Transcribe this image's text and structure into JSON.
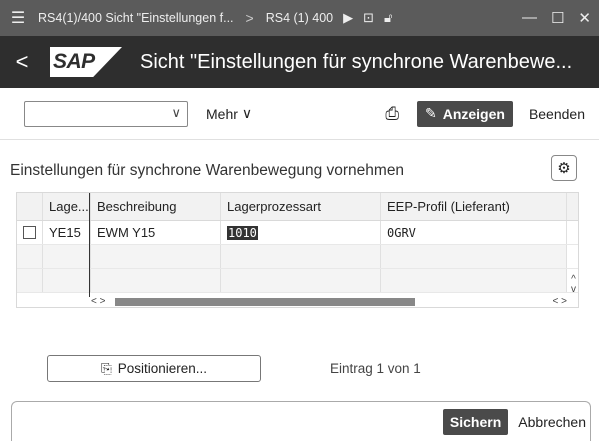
{
  "titlebar": {
    "title": "RS4(1)/400 Sicht \"Einstellungen f...",
    "separator": ">",
    "system": "RS4 (1) 400",
    "icons": [
      "play-icon",
      "transaction-icon",
      "lock-icon"
    ]
  },
  "header": {
    "back": "<",
    "logo": "SAP",
    "title": "Sicht \"Einstellungen für synchrone Warenbewe..."
  },
  "toolbar": {
    "select_value": "",
    "mehr_label": "Mehr",
    "anzeigen_label": "Anzeigen",
    "beenden_label": "Beenden"
  },
  "section": {
    "title": "Einstellungen für synchrone Warenbewegung vornehmen"
  },
  "table": {
    "columns": [
      "Lage...",
      "Beschreibung",
      "Lagerprozessart",
      "EEP-Profil (Lieferant)"
    ],
    "rows": [
      {
        "lager": "YE15",
        "beschreibung": "EWM Y15",
        "prozessart": "1010",
        "eep": "0GRV"
      }
    ]
  },
  "positionieren_label": "Positionieren...",
  "eintrag_text": "Eintrag 1 von 1",
  "footer": {
    "sichern_label": "Sichern",
    "abbrechen_label": "Abbrechen"
  },
  "colors": {
    "titlebar": "#5b5b5b",
    "header": "#2e2e2e",
    "primary_button": "#4a4a4a"
  }
}
